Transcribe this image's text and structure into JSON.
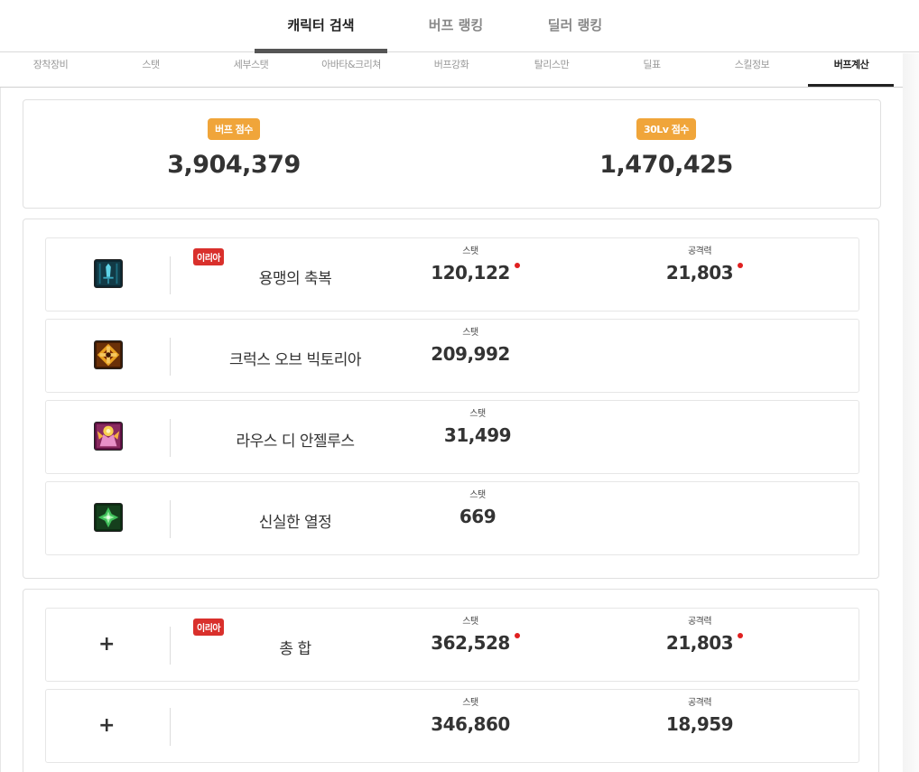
{
  "top_tabs": [
    {
      "label": "캐릭터 검색",
      "active": true
    },
    {
      "label": "버프 랭킹",
      "active": false
    },
    {
      "label": "딜러 랭킹",
      "active": false
    }
  ],
  "sub_tabs": [
    {
      "label": "장착장비"
    },
    {
      "label": "스탯"
    },
    {
      "label": "세부스탯"
    },
    {
      "label": "아바타&크리쳐"
    },
    {
      "label": "버프강화"
    },
    {
      "label": "탈리스만"
    },
    {
      "label": "딜표"
    },
    {
      "label": "스킬정보"
    },
    {
      "label": "버프계산"
    }
  ],
  "scores": {
    "buff_label": "버프 점수",
    "buff_value": "3,904,379",
    "lv30_label": "30Lv 점수",
    "lv30_value": "1,470,425"
  },
  "skills": [
    {
      "name": "용맹의 축복",
      "badge": "이리아",
      "stat_label": "스탯",
      "stat": "120,122",
      "atk_label": "공격력",
      "atk": "21,803",
      "icon": "sword-skill-icon",
      "color": "#1b4a5a"
    },
    {
      "name": "크럭스 오브 빅토리아",
      "badge": "",
      "stat_label": "스탯",
      "stat": "209,992",
      "icon": "cross-skill-icon",
      "color": "#7a3a10"
    },
    {
      "name": "라우스 디 안젤루스",
      "badge": "",
      "stat_label": "스탯",
      "stat": "31,499",
      "icon": "angel-skill-icon",
      "color": "#a0367a"
    },
    {
      "name": "신실한 열정",
      "badge": "",
      "stat_label": "스탯",
      "stat": "669",
      "icon": "zeal-skill-icon",
      "color": "#1f5a2a"
    }
  ],
  "totals": [
    {
      "name": "총 합",
      "badge": "이리아",
      "stat_label": "스탯",
      "stat": "362,528",
      "atk_label": "공격력",
      "atk": "21,803"
    },
    {
      "name": "",
      "badge": "",
      "stat_label": "스탯",
      "stat": "346,860",
      "atk_label": "공격력",
      "atk": "18,959"
    }
  ],
  "plus_symbol": "+"
}
